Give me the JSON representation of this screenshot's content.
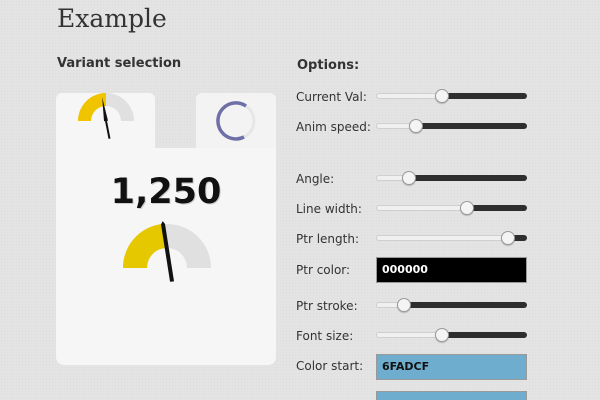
{
  "page": {
    "title": "Example"
  },
  "variants": {
    "heading": "Variant selection",
    "tabs": [
      {
        "name": "gauge",
        "selected": true,
        "icon": "gauge-icon"
      },
      {
        "name": "donut",
        "selected": false,
        "icon": "donut-icon"
      }
    ]
  },
  "preview": {
    "value_text": "1,250",
    "gauge_fill_color": "#e0c000",
    "gauge_track_color": "#e0e0e0",
    "pointer_color": "#000000"
  },
  "options": {
    "heading": "Options:",
    "current_val": {
      "label": "Current Val:",
      "level": 0.43
    },
    "anim_speed": {
      "label": "Anim speed:",
      "level": 0.24
    },
    "angle": {
      "label": "Angle:",
      "level": 0.19
    },
    "line_width": {
      "label": "Line width:",
      "level": 0.61
    },
    "ptr_length": {
      "label": "Ptr length:",
      "level": 0.91
    },
    "ptr_color": {
      "label": "Ptr color:",
      "value": "000000",
      "color": "#000000"
    },
    "ptr_stroke": {
      "label": "Ptr stroke:",
      "level": 0.15
    },
    "font_size": {
      "label": "Font size:",
      "level": 0.43
    },
    "color_start": {
      "label": "Color start:",
      "value": "6FADCF",
      "color": "#6fadcf"
    }
  }
}
